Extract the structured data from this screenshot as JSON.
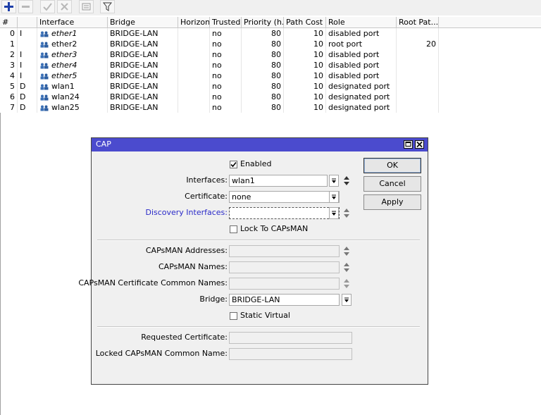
{
  "toolbar": {
    "icons": [
      "add-icon",
      "remove-icon",
      "enable-icon",
      "disable-icon",
      "comment-icon",
      "filter-icon"
    ]
  },
  "table": {
    "columns": [
      "#",
      "",
      "Interface",
      "Bridge",
      "Horizon",
      "Trusted",
      "Priority (h...",
      "Path Cost",
      "Role",
      "Root Pat..."
    ],
    "rows": [
      {
        "num": "0",
        "flag": "I",
        "iface": "ether1",
        "bridge": "BRIDGE-LAN",
        "horizon": "",
        "trusted": "no",
        "priority": "80",
        "cost": "10",
        "role": "disabled port",
        "rootpath": "",
        "inactive": true
      },
      {
        "num": "1",
        "flag": "",
        "iface": "ether2",
        "bridge": "BRIDGE-LAN",
        "horizon": "",
        "trusted": "no",
        "priority": "80",
        "cost": "10",
        "role": "root port",
        "rootpath": "20",
        "inactive": false
      },
      {
        "num": "2",
        "flag": "I",
        "iface": "ether3",
        "bridge": "BRIDGE-LAN",
        "horizon": "",
        "trusted": "no",
        "priority": "80",
        "cost": "10",
        "role": "disabled port",
        "rootpath": "",
        "inactive": true
      },
      {
        "num": "3",
        "flag": "I",
        "iface": "ether4",
        "bridge": "BRIDGE-LAN",
        "horizon": "",
        "trusted": "no",
        "priority": "80",
        "cost": "10",
        "role": "disabled port",
        "rootpath": "",
        "inactive": true
      },
      {
        "num": "4",
        "flag": "I",
        "iface": "ether5",
        "bridge": "BRIDGE-LAN",
        "horizon": "",
        "trusted": "no",
        "priority": "80",
        "cost": "10",
        "role": "disabled port",
        "rootpath": "",
        "inactive": true
      },
      {
        "num": "5",
        "flag": "D",
        "iface": "wlan1",
        "bridge": "BRIDGE-LAN",
        "horizon": "",
        "trusted": "no",
        "priority": "80",
        "cost": "10",
        "role": "designated port",
        "rootpath": "",
        "inactive": false
      },
      {
        "num": "6",
        "flag": "D",
        "iface": "wlan24",
        "bridge": "BRIDGE-LAN",
        "horizon": "",
        "trusted": "no",
        "priority": "80",
        "cost": "10",
        "role": "designated port",
        "rootpath": "",
        "inactive": false
      },
      {
        "num": "7",
        "flag": "D",
        "iface": "wlan25",
        "bridge": "BRIDGE-LAN",
        "horizon": "",
        "trusted": "no",
        "priority": "80",
        "cost": "10",
        "role": "designated port",
        "rootpath": "",
        "inactive": false
      }
    ]
  },
  "dialog": {
    "title": "CAP",
    "enabled_label": "Enabled",
    "enabled_checked": true,
    "interfaces_label": "Interfaces:",
    "interfaces_value": "wlan1",
    "certificate_label": "Certificate:",
    "certificate_value": "none",
    "discovery_label": "Discovery Interfaces:",
    "discovery_value": "",
    "lock_label": "Lock To CAPsMAN",
    "lock_checked": false,
    "capsman_addresses_label": "CAPsMAN Addresses:",
    "capsman_names_label": "CAPsMAN Names:",
    "capsman_cert_cn_label": "CAPsMAN Certificate Common Names:",
    "bridge_label": "Bridge:",
    "bridge_value": "BRIDGE-LAN",
    "static_virtual_label": "Static Virtual",
    "static_virtual_checked": false,
    "requested_cert_label": "Requested Certificate:",
    "locked_capsman_cn_label": "Locked CAPsMAN Common Name:",
    "ok_label": "OK",
    "cancel_label": "Cancel",
    "apply_label": "Apply"
  },
  "colors": {
    "titlebar": "#4b4bce",
    "discovery_label": "#2a2ac8",
    "add_icon": "#1e3fa8"
  }
}
